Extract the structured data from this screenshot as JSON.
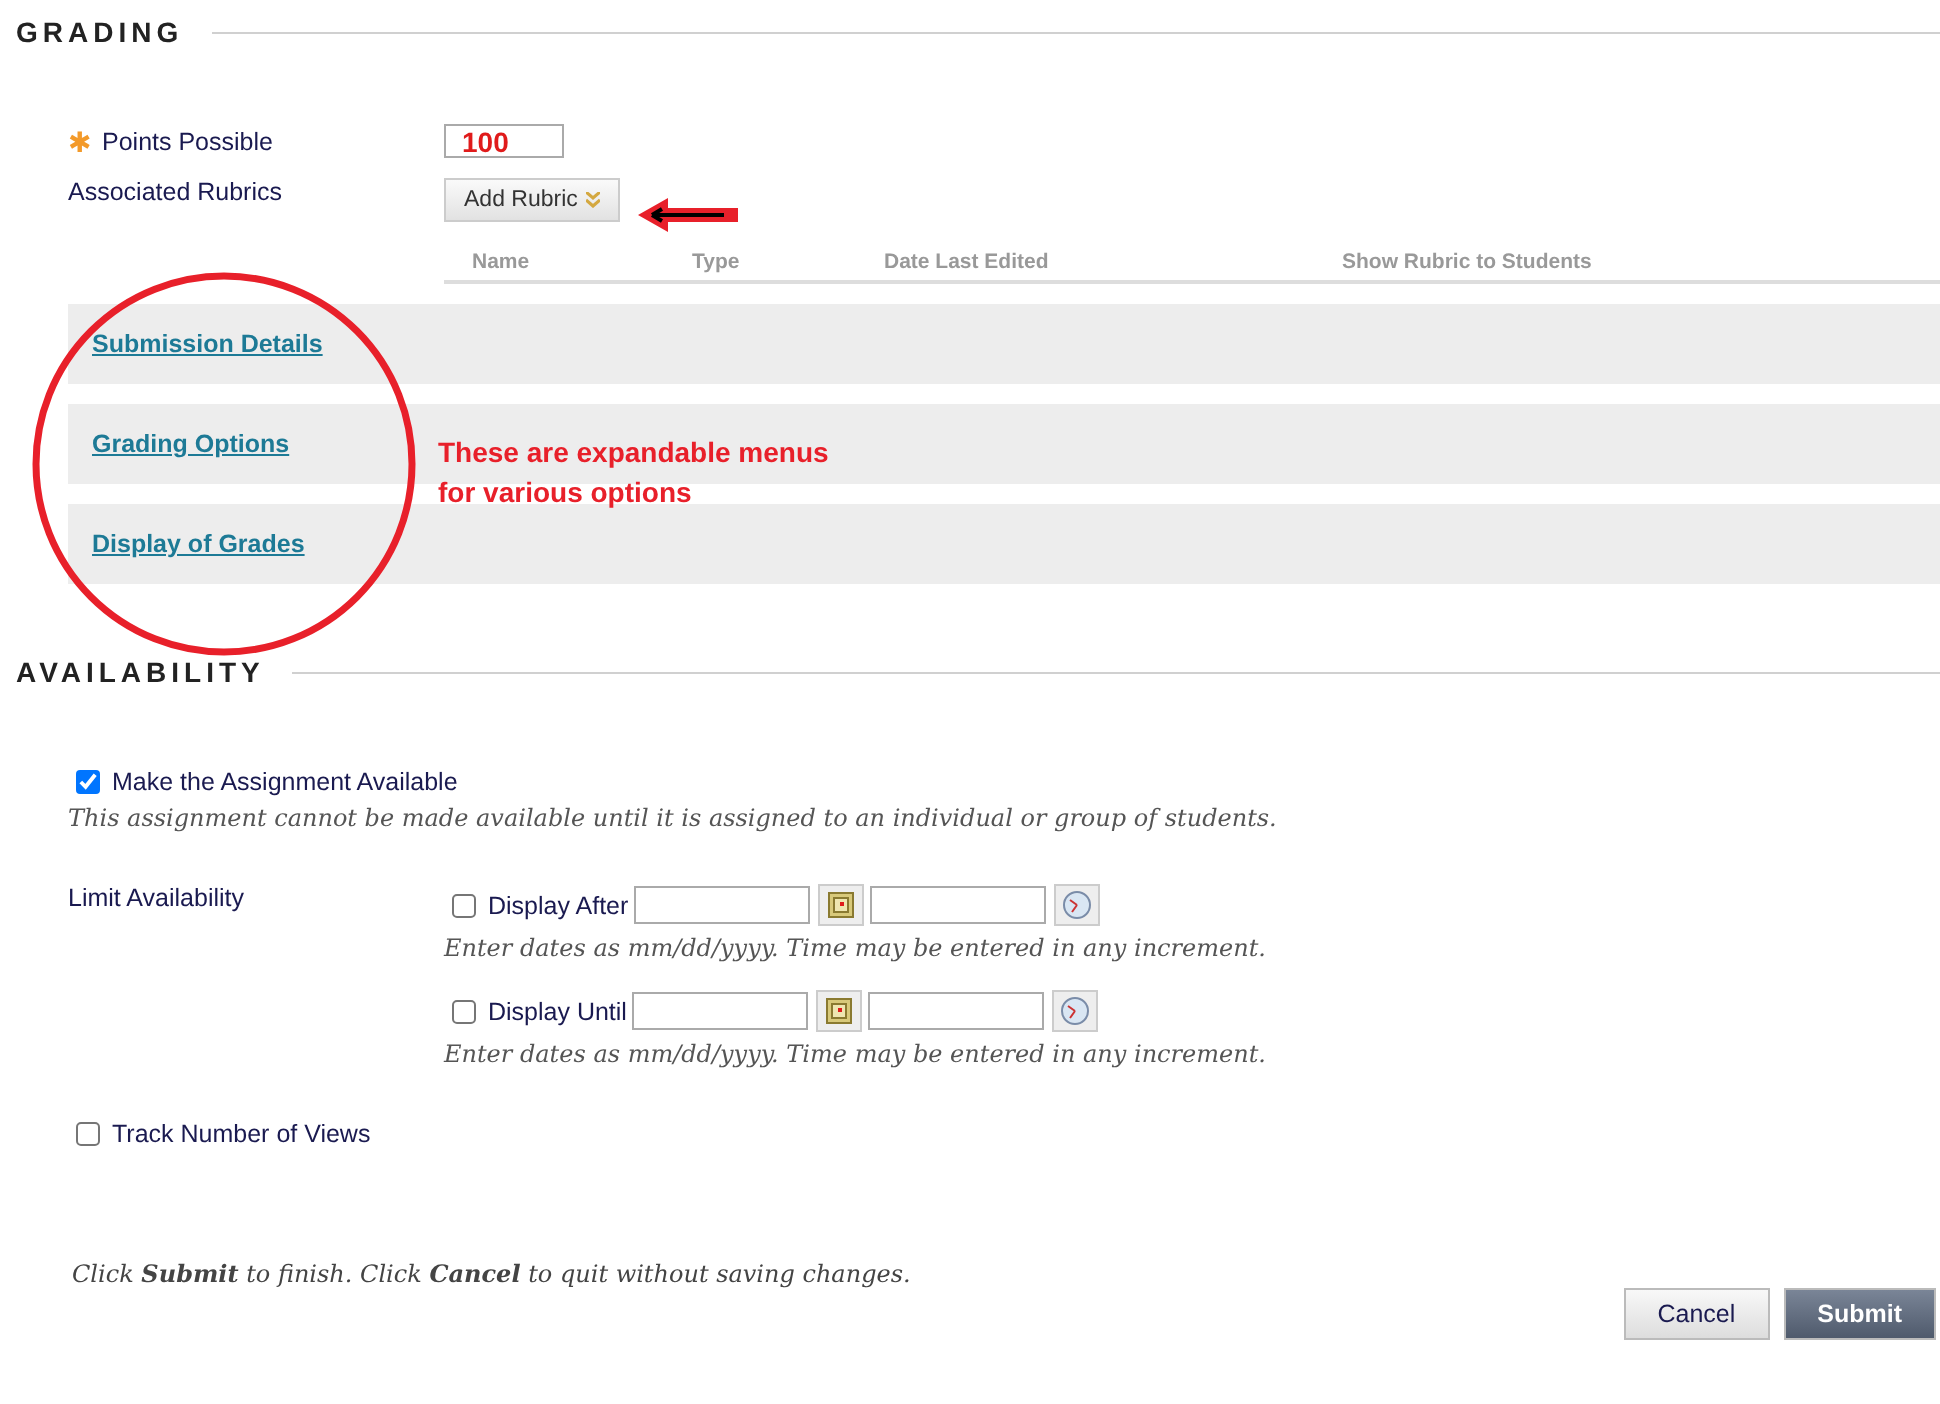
{
  "grading": {
    "heading": "GRADING",
    "points": {
      "required_mark": "✱",
      "label": "Points Possible",
      "value": "100"
    },
    "rubrics": {
      "label": "Associated Rubrics",
      "button": "Add Rubric",
      "columns": [
        "Name",
        "Type",
        "Date Last Edited",
        "Show Rubric to Students"
      ]
    },
    "sections": [
      {
        "label": "Submission Details",
        "expanded": false
      },
      {
        "label": "Grading Options",
        "expanded": false
      },
      {
        "label": "Display of Grades",
        "expanded": false
      }
    ]
  },
  "annotation": {
    "text": [
      "These are expandable menus",
      "for various options"
    ]
  },
  "availability": {
    "heading": "AVAILABILITY",
    "make_available": {
      "label": "Make the Assignment Available",
      "checked": true,
      "note": "This assignment cannot be made available until it is assigned to an individual or group of students."
    },
    "limit": {
      "label": "Limit Availability",
      "rows": [
        {
          "label": "Display After",
          "checked": false,
          "help": "Enter dates as mm/dd/yyyy. Time may be entered in any increment."
        },
        {
          "label": "Display Until",
          "checked": false,
          "help": "Enter dates as mm/dd/yyyy. Time may be entered in any increment."
        }
      ]
    },
    "track_views": {
      "label": "Track Number of Views",
      "checked": false
    }
  },
  "footer": {
    "instructions": "Click **Submit** to finish. Click **Cancel** to quit without saving changes.",
    "buttons": [
      "Cancel",
      "Submit"
    ]
  }
}
